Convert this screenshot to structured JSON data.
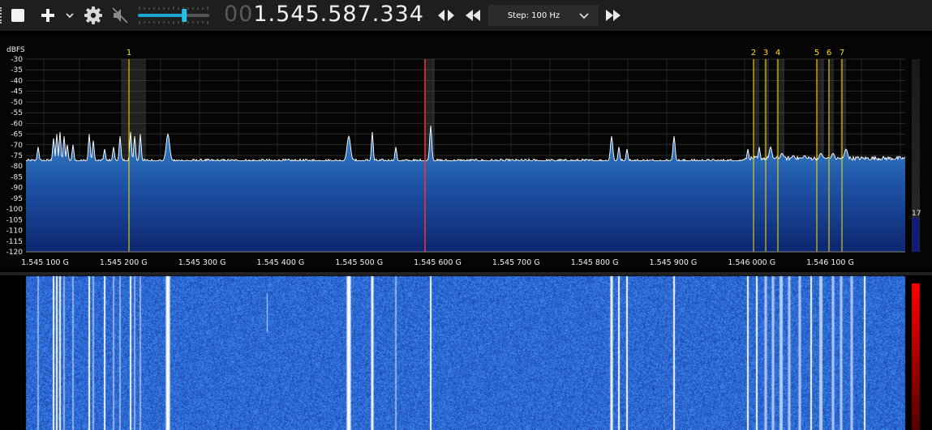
{
  "toolbar": {
    "frequency_dim": "00",
    "frequency_main": "1.545.587.334",
    "step_label": "Step: 100 Hz",
    "volume_fraction": 0.65
  },
  "icons": {
    "grip": "grip-icon",
    "play": "stop-square-icon",
    "add": "plus-icon",
    "add_dropdown": "chevron-down-icon",
    "settings": "gear-icon",
    "mute": "speaker-muted-icon",
    "center": "center-arrows-icon",
    "rewind": "rewind-icon",
    "step_dropdown": "chevron-down-icon",
    "forward": "fast-forward-icon"
  },
  "spectrum": {
    "unit_label": "dBFS",
    "y_ticks": [
      "-30",
      "-35",
      "-40",
      "-45",
      "-50",
      "-55",
      "-60",
      "-65",
      "-70",
      "-75",
      "-80",
      "-85",
      "-90",
      "-95",
      "-100",
      "-105",
      "-110",
      "-115",
      "-120"
    ],
    "x_ticks": [
      "1.545 100 G",
      "1.545 200 G",
      "1.545 300 G",
      "1.545 400 G",
      "1.545 500 G",
      "1.545 600 G",
      "1.545 700 G",
      "1.545 800 G",
      "1.545 900 G",
      "1.546 000 G",
      "1.546 100 G"
    ],
    "markers": [
      "1",
      "2",
      "3",
      "4",
      "5",
      "6",
      "7"
    ],
    "squelch_value": "17",
    "colors": {
      "trace": "#ffffff",
      "fill_top": "#3a86c8",
      "fill_bottom": "#0d2670",
      "marker": "#ffe000",
      "tuner": "#ff3030",
      "grid": "#3a3a3a"
    }
  },
  "waterfall": {
    "colors": {
      "background": "#2f5fd0",
      "signal": "#ffffff",
      "scale_top": "#ff0000",
      "scale_bottom": "#550000"
    }
  }
}
